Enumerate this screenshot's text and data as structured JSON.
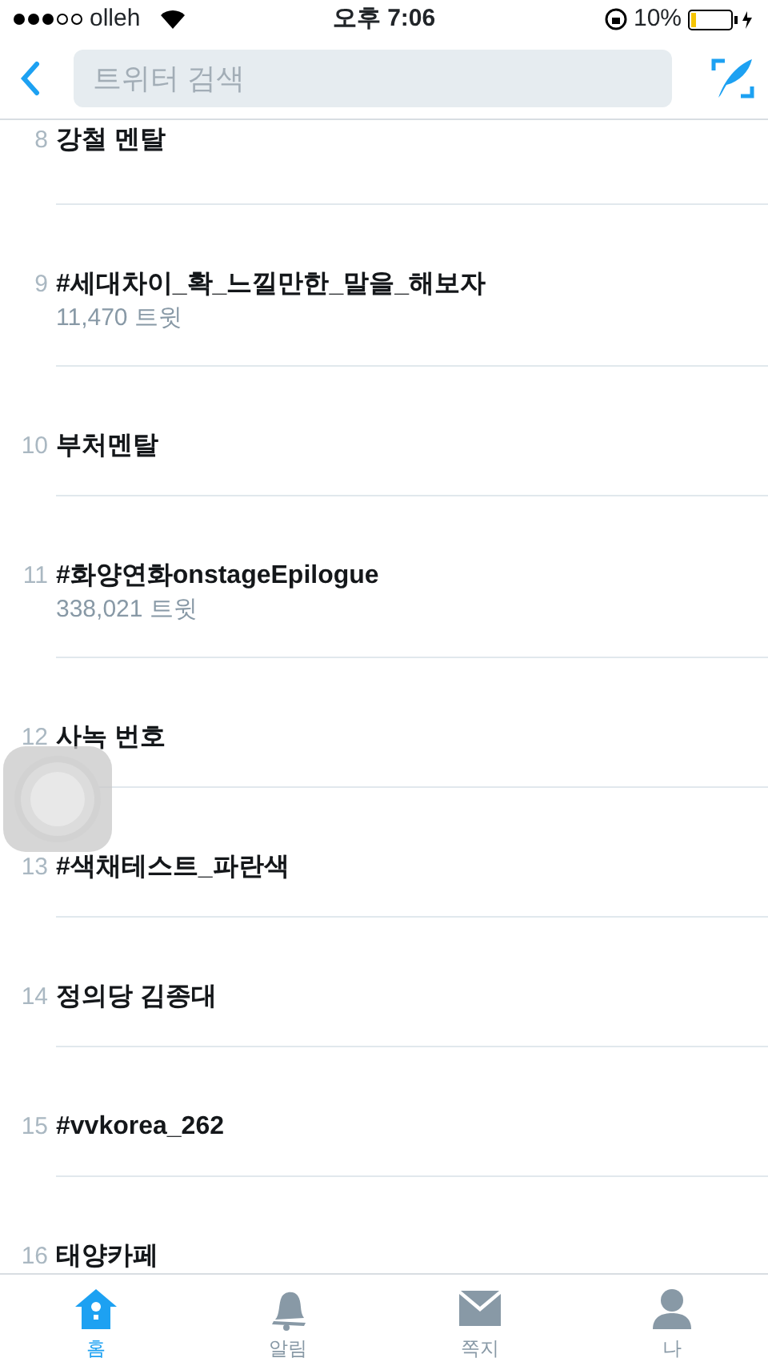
{
  "status_bar": {
    "carrier": "olleh",
    "time": "오후 7:06",
    "battery": "10%"
  },
  "search": {
    "placeholder": "트위터 검색"
  },
  "trends": [
    {
      "rank": "8",
      "title": "강철 멘탈"
    },
    {
      "rank": "9",
      "title": "#세대차이_확_느낄만한_말을_해보자",
      "count": "11,470 트윗"
    },
    {
      "rank": "10",
      "title": "부처멘탈"
    },
    {
      "rank": "11",
      "title": "#화양연화onstageEpilogue",
      "count": "338,021 트윗"
    },
    {
      "rank": "12",
      "title": "사녹 번호"
    },
    {
      "rank": "13",
      "title": "#색채테스트_파란색"
    },
    {
      "rank": "14",
      "title": "정의당 김종대"
    },
    {
      "rank": "15",
      "title": "#vvkorea_262"
    },
    {
      "rank": "16",
      "title": "태양카페"
    }
  ],
  "tab_bar": [
    {
      "kind": "home",
      "label": "홈",
      "selected": true
    },
    {
      "kind": "bell",
      "label": "알림",
      "selected": false
    },
    {
      "kind": "mail",
      "label": "쪽지",
      "selected": false
    },
    {
      "kind": "person",
      "label": "나",
      "selected": false
    }
  ]
}
